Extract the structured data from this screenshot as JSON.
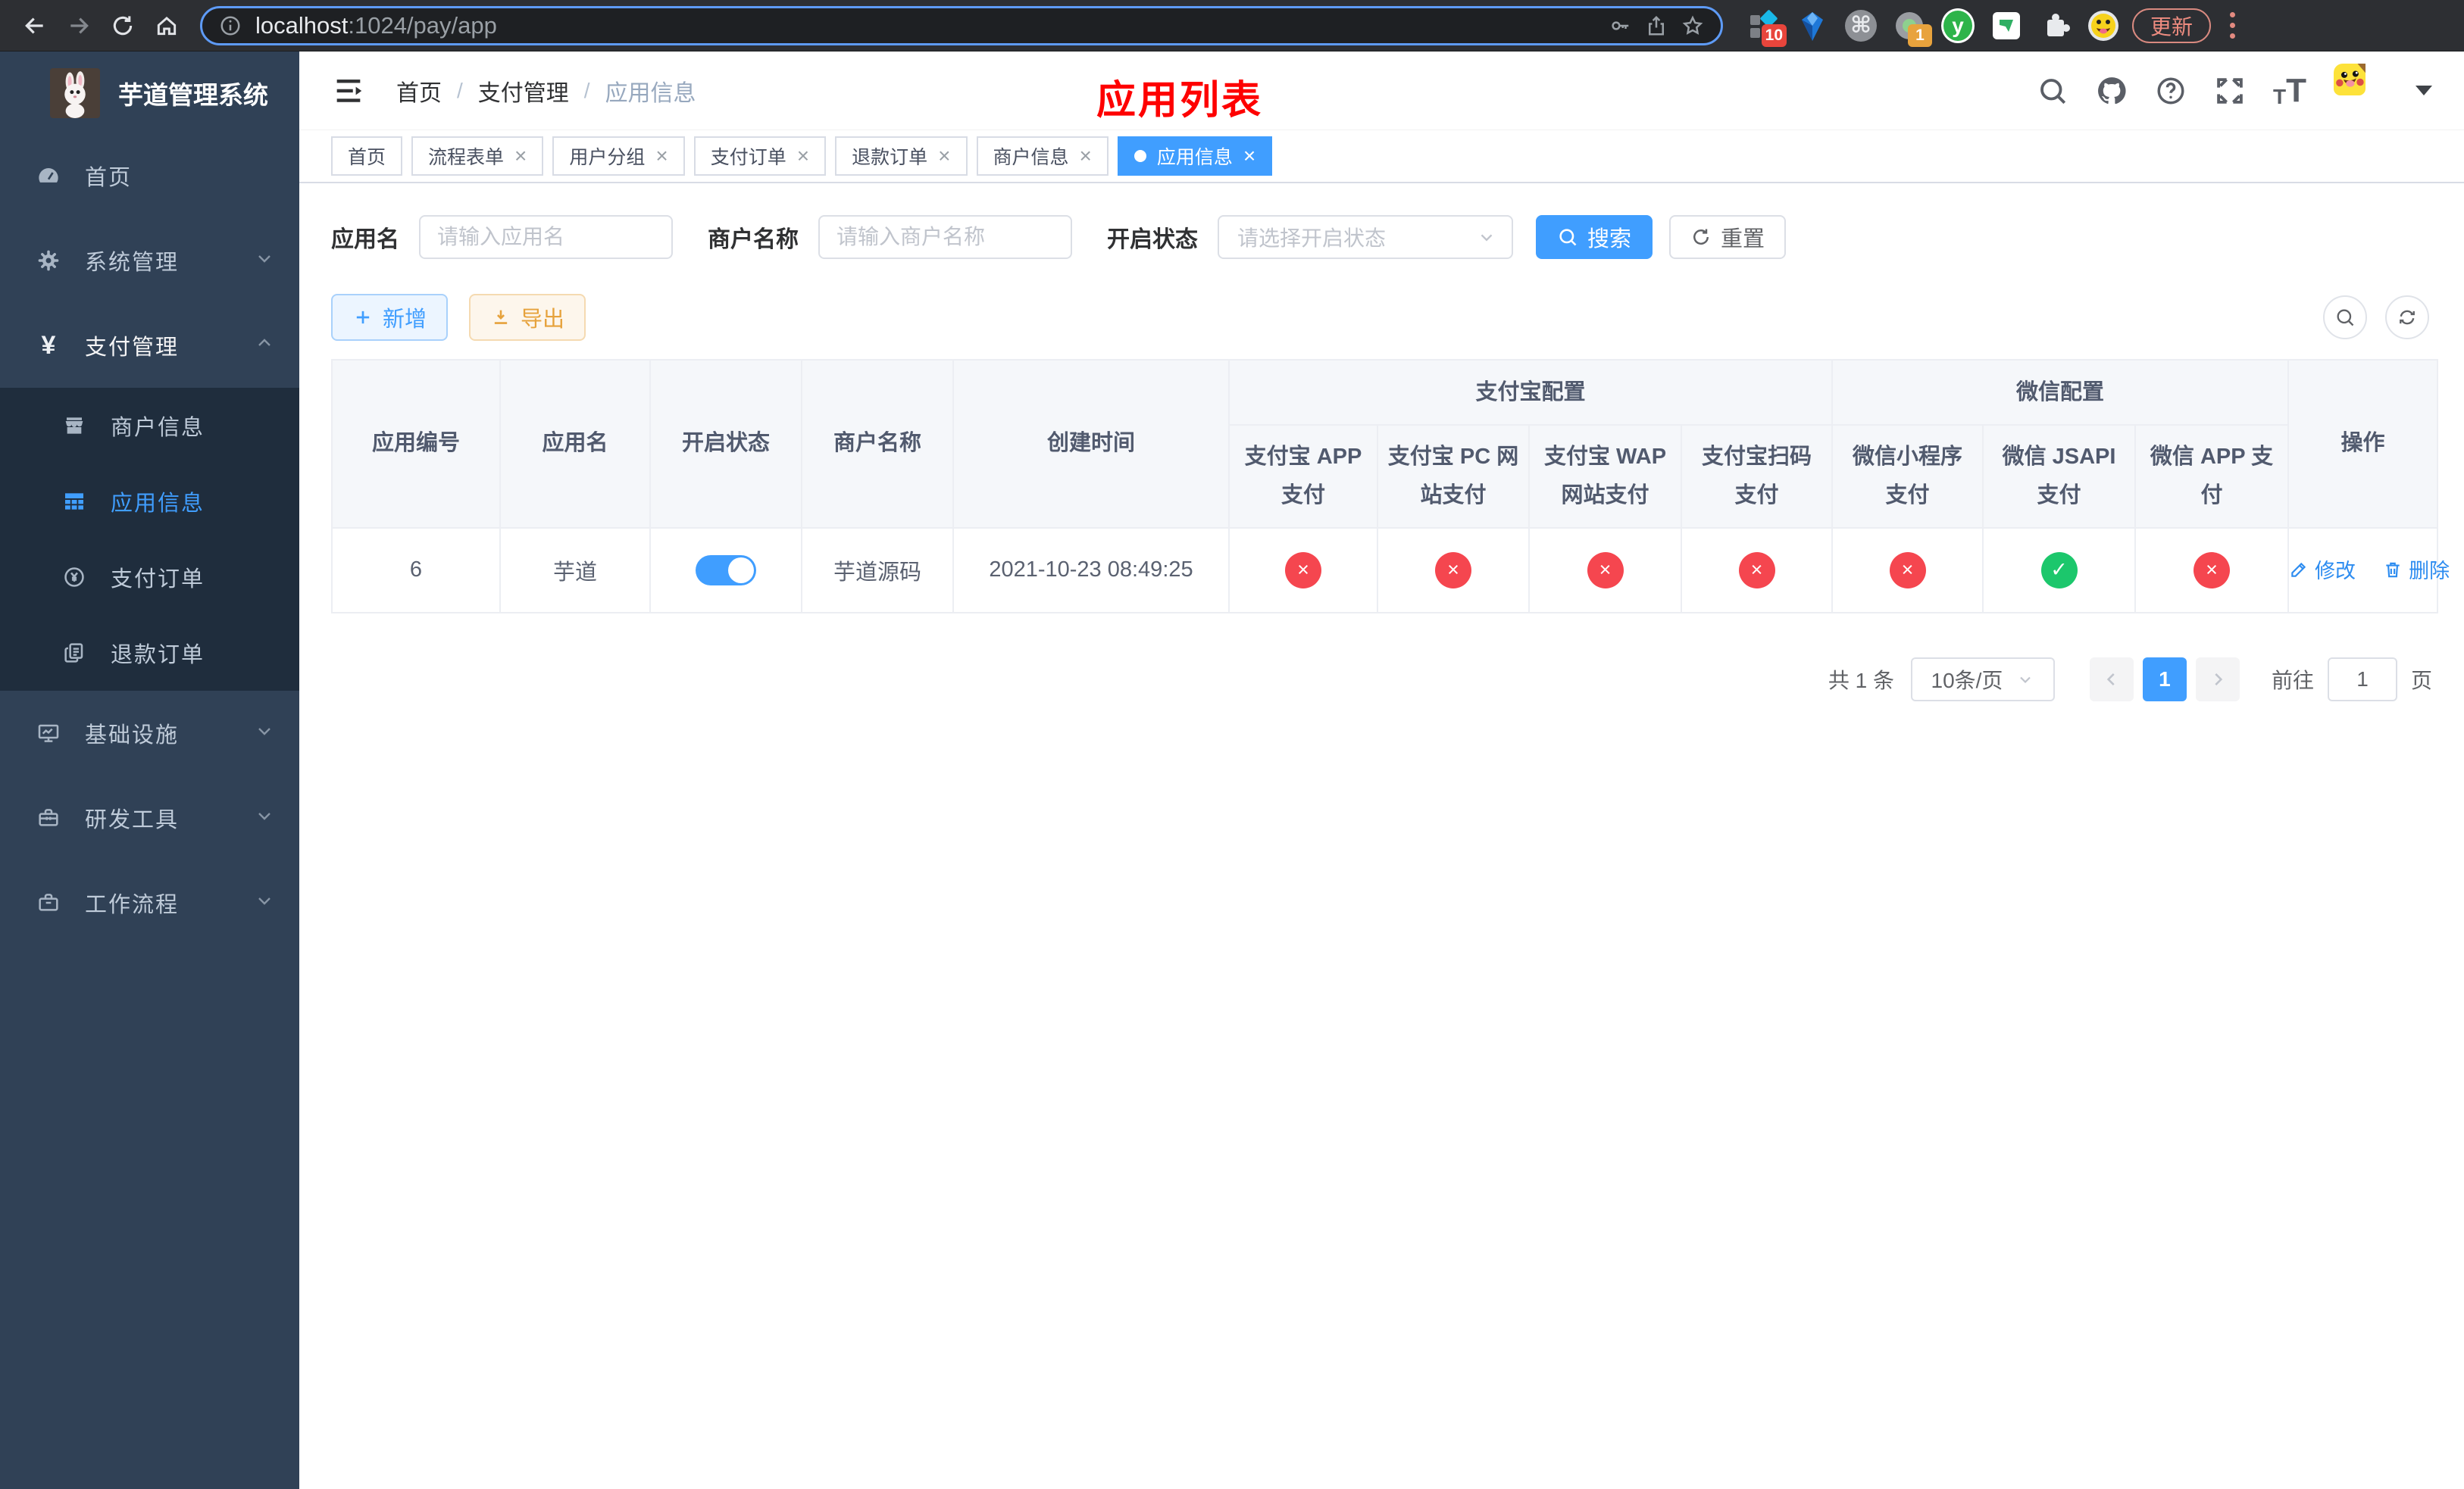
{
  "colors": {
    "accent": "#409eff",
    "danger": "#f5464f",
    "success": "#1cc76c",
    "warning": "#e6a23c",
    "annotation": "#fe0000",
    "sidebar_bg": "#304156",
    "submenu_bg": "#1f2d3d"
  },
  "browser": {
    "url_host": "localhost",
    "url_rest": ":1024/pay/app",
    "update_label": "更新",
    "ext_badge_ten": "10",
    "ext_badge_one": "1",
    "ext_y_label": "y",
    "ext_cmd_glyph": "⌘"
  },
  "sidebar": {
    "title": "芋道管理系统",
    "items": [
      {
        "label": "首页"
      },
      {
        "label": "系统管理"
      },
      {
        "label": "支付管理"
      },
      {
        "label": "基础设施"
      },
      {
        "label": "研发工具"
      },
      {
        "label": "工作流程"
      }
    ],
    "yen_glyph": "¥",
    "submenu": [
      {
        "label": "商户信息"
      },
      {
        "label": "应用信息"
      },
      {
        "label": "支付订单"
      },
      {
        "label": "退款订单"
      }
    ]
  },
  "header": {
    "breadcrumb": [
      "首页",
      "支付管理",
      "应用信息"
    ],
    "breadcrumb_sep": "/",
    "annotation": "应用列表"
  },
  "tabs": [
    {
      "cls": "tag",
      "label": "首页",
      "closable": false
    },
    {
      "cls": "tag",
      "label": "流程表单",
      "closable": true
    },
    {
      "cls": "tag",
      "label": "用户分组",
      "closable": true
    },
    {
      "cls": "tag",
      "label": "支付订单",
      "closable": true
    },
    {
      "cls": "tag",
      "label": "退款订单",
      "closable": true
    },
    {
      "cls": "tag",
      "label": "商户信息",
      "closable": true
    },
    {
      "cls": "tag active",
      "label": "应用信息",
      "closable": true
    }
  ],
  "icons": {
    "close": "×"
  },
  "filters": {
    "app_name_label": "应用名",
    "app_name_placeholder": "请输入应用名",
    "merchant_label": "商户名称",
    "merchant_placeholder": "请输入商户名称",
    "status_label": "开启状态",
    "status_placeholder": "请选择开启状态",
    "search_label": "搜索",
    "reset_label": "重置"
  },
  "toolbar": {
    "add_label": "新增",
    "export_label": "导出"
  },
  "table": {
    "headers": {
      "app_id": "应用编号",
      "app_name": "应用名",
      "status": "开启状态",
      "merchant": "商户名称",
      "created": "创建时间",
      "alipay_group": "支付宝配置",
      "wechat_group": "微信配置",
      "alipay_app": "支付宝 APP 支付",
      "alipay_pc": "支付宝 PC 网站支付",
      "alipay_wap": "支付宝 WAP 网站支付",
      "alipay_qr": "支付宝扫码支付",
      "wx_mini": "微信小程序支付",
      "wx_jsapi": "微信 JSAPI 支付",
      "wx_app": "微信 APP 支付",
      "actions": "操作"
    },
    "row": {
      "app_id": "6",
      "app_name": "芋道",
      "toggle_class": "el-switch on",
      "merchant": "芋道源码",
      "created": "2021-10-23 08:49:25",
      "statuses": [
        {
          "cls": "st st-red",
          "glyph": "×"
        },
        {
          "cls": "st st-red",
          "glyph": "×"
        },
        {
          "cls": "st st-red",
          "glyph": "×"
        },
        {
          "cls": "st st-red",
          "glyph": "×"
        },
        {
          "cls": "st st-red",
          "glyph": "×"
        },
        {
          "cls": "st st-green",
          "glyph": "✓"
        },
        {
          "cls": "st st-red",
          "glyph": "×"
        }
      ],
      "edit_label": "修改",
      "delete_label": "删除"
    }
  },
  "pagination": {
    "total": "共 1 条",
    "per_page": "10条/页",
    "page": "1",
    "goto_label": "前往",
    "goto_value": "1",
    "unit_label": "页"
  }
}
